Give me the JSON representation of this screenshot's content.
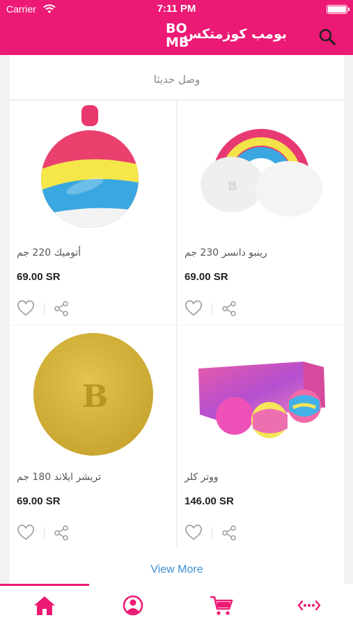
{
  "status_bar": {
    "carrier": "Carrier",
    "time": "7:11 PM"
  },
  "header": {
    "brand_name": "بومب كوزمتكس",
    "logo_text": [
      "BO",
      "MB"
    ]
  },
  "section": {
    "title": "وصل حديثا"
  },
  "products": [
    {
      "name": "أتوميك 220 جم",
      "price": "69.00 SR"
    },
    {
      "name": "رينبو دانسر 230 جم",
      "price": "69.00 SR"
    },
    {
      "name": "تريشر ايلاند 180 جم",
      "price": "69.00 SR"
    },
    {
      "name": "ووتر كلر",
      "price": "146.00 SR"
    }
  ],
  "view_more_label": "View More",
  "colors": {
    "brand": "#ec1a74",
    "link": "#3d8fd6"
  },
  "tabs": [
    {
      "icon": "home-icon",
      "active": true
    },
    {
      "icon": "profile-icon",
      "active": false
    },
    {
      "icon": "cart-icon",
      "active": false
    },
    {
      "icon": "more-icon",
      "active": false
    }
  ]
}
